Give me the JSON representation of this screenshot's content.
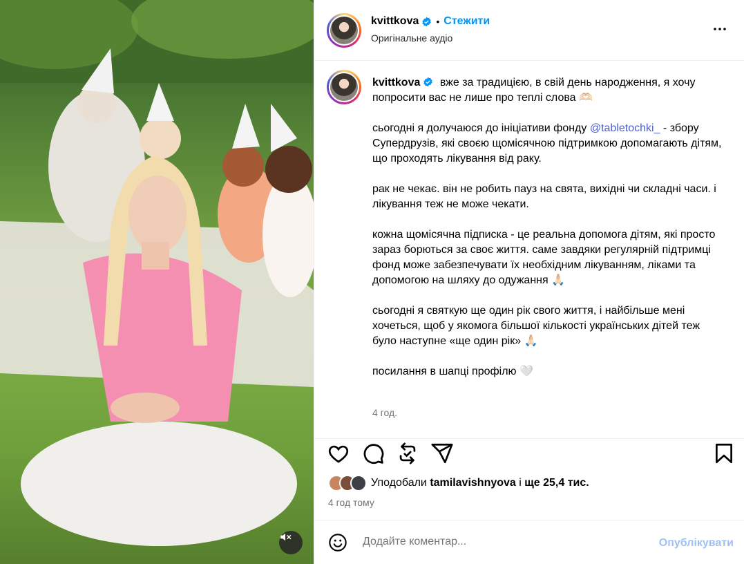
{
  "post": {
    "username": "kvittkova",
    "follow_label": "Стежити",
    "audio_label": "Оригінальне аудіо",
    "more_icon": "more-horizontal-icon",
    "verified_icon": "verified-badge-icon"
  },
  "caption": {
    "username": "kvittkova",
    "line1": "вже за традицією, в свій день народження, я хочу попросити вас не лише про теплі слова 🫶🏻",
    "p2_before": "сьогодні я долучаюся до ініціативи фонду ",
    "p2_mention": "@tabletochki_",
    "p2_after": " - збору Супердрузів, які своєю щомісячною підтримкою допомагають дітям, що проходять лікування від раку.",
    "p3": "рак не чекає. він не робить пауз на свята, вихідні чи складні часи. і лікування теж не може чекати.",
    "p4": "кожна щомісячна підписка - це реальна допомога дітям, які просто зараз борються за своє життя. саме завдяки регулярній підтримці фонд може забезпечувати їх необхідним лікуванням, ліками та допомогою на шляху до одужання 🙏🏻",
    "p5": "сьогодні я святкую ще один рік свого життя, і найбільше мені хочеться, щоб у якомога більшої кількості українських дітей теж було наступне «ще один рік» 🙏🏻",
    "p6": "посилання в шапці профілю 🤍",
    "time": "4 год."
  },
  "actions": {
    "like_icon": "heart-icon",
    "comment_icon": "comment-icon",
    "repost_icon": "repost-icon",
    "share_icon": "share-icon",
    "save_icon": "bookmark-icon"
  },
  "likes": {
    "prefix": "Уподобали ",
    "user": "tamilavishnyova",
    "middle": " і ",
    "count": "ще 25,4 тис."
  },
  "timestamp": "4 год тому",
  "comment": {
    "placeholder": "Додайте коментар...",
    "publish_label": "Опублікувати",
    "emoji_icon": "emoji-icon"
  },
  "media": {
    "mute_icon": "muted-speaker-icon"
  }
}
